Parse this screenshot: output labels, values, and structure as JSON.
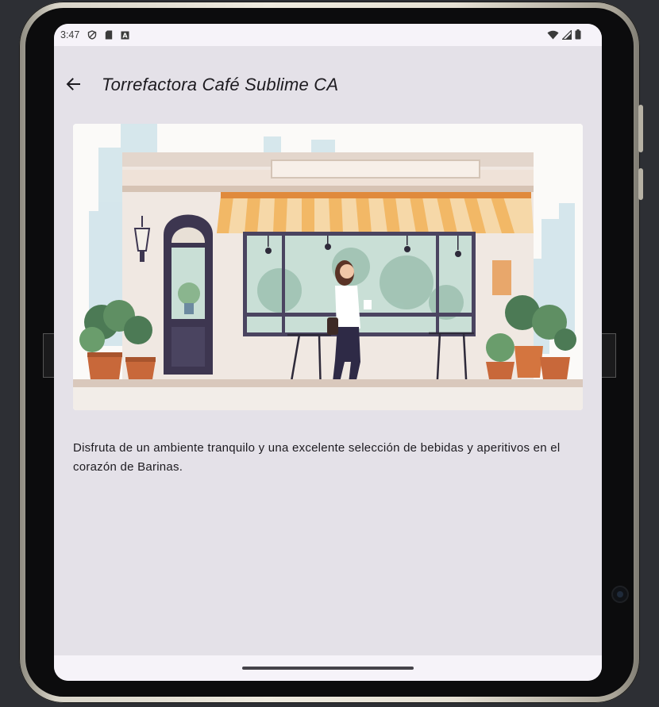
{
  "status_bar": {
    "time": "3:47",
    "icons": [
      "vpn-shield-icon",
      "sd-card-icon",
      "a-app-icon",
      "wifi-icon",
      "cell-signal-icon",
      "battery-icon"
    ]
  },
  "app_bar": {
    "back_icon": "arrow-back-icon",
    "title": "Torrefactora Café Sublime CA"
  },
  "hero_image": {
    "subject": "cafe-storefront-illustration"
  },
  "description": "Disfruta de un ambiente tranquilo y una excelente selección de bebidas y aperitivos en el corazón de Barinas.",
  "colors": {
    "background": "#e4e1e8",
    "bars": "#f6f3f9",
    "text": "#1d1b20",
    "awning": "#f2b866"
  }
}
